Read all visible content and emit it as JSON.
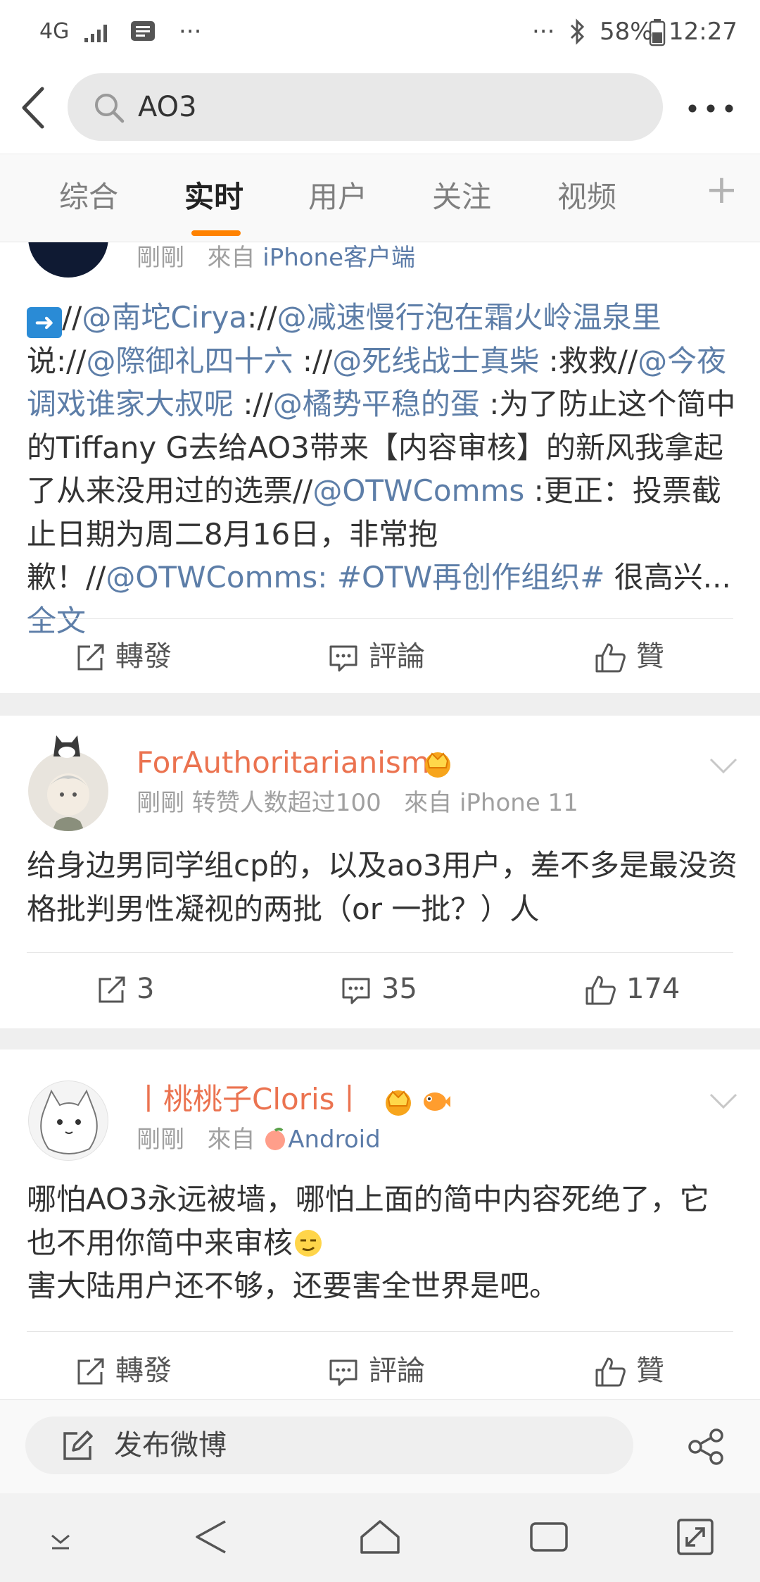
{
  "status_bar": {
    "network": "4G",
    "ellipsis_left": "···",
    "ellipsis_right": "···",
    "battery": "58%",
    "time": "12:27"
  },
  "search": {
    "query": "AO3"
  },
  "tabs": [
    {
      "label": "综合"
    },
    {
      "label": "实时"
    },
    {
      "label": "用户"
    },
    {
      "label": "关注"
    },
    {
      "label": "视频"
    }
  ],
  "tab_add": "+",
  "posts": [
    {
      "time": "剛剛",
      "source_prefix": "來自",
      "source": "iPhone客户端",
      "body": {
        "arrow": "➡️",
        "t1": "//",
        "m1": "@南坨Cirya",
        "t2": "://",
        "m2": "@减速慢行泡在霜火岭温泉里",
        "t3": "说://",
        "m3": "@際御礼四十六",
        "t4": " ://",
        "m4": "@死线战士真柴",
        "t5": " :救救//",
        "m5": "@今夜调戏谁家大叔呢",
        "t6": " ://",
        "m6": "@橘势平稳的蛋",
        "t7": " :为了防止这个简中的Tiffany G去给AO3带来【内容审核】的新风我拿起了从来没用过的选票//",
        "m7": "@OTWComms",
        "t8": " :更正：投票截止日期为周二8月16日，非常抱歉！//",
        "m8": "@OTWComms",
        "t9": ": ",
        "h1": "#OTW再创作组织#",
        "t10": " 很高兴...",
        "more": " 全文"
      },
      "actions": {
        "repost": "轉發",
        "comment": "評論",
        "like": "贊"
      }
    },
    {
      "username": "ForAuthoritarianism",
      "time": "剛剛",
      "extra": "转赞人数超过100",
      "source_prefix": "來自",
      "source": "iPhone 11",
      "body": "给身边男同学组cp的，以及ao3用户，差不多是最没资格批判男性凝视的两批（or 一批？）人",
      "actions": {
        "repost": "3",
        "comment": "35",
        "like": "174"
      }
    },
    {
      "username": "丨桃桃子Cloris丨",
      "time": "剛剛",
      "source_prefix": "來自",
      "source": "Android",
      "body_line1": "哪怕AO3永远被墙，哪怕上面的简中内容死绝了，它也不用你简中来审核",
      "body_line2": "害大陆用户还不够，还要害全世界是吧。",
      "actions": {
        "repost": "轉發",
        "comment": "評論",
        "like": "贊"
      }
    }
  ],
  "compose": {
    "label": "发布微博"
  },
  "colors": {
    "accent": "#ff8200",
    "username": "#eb7350",
    "link": "#5d7ea8"
  }
}
